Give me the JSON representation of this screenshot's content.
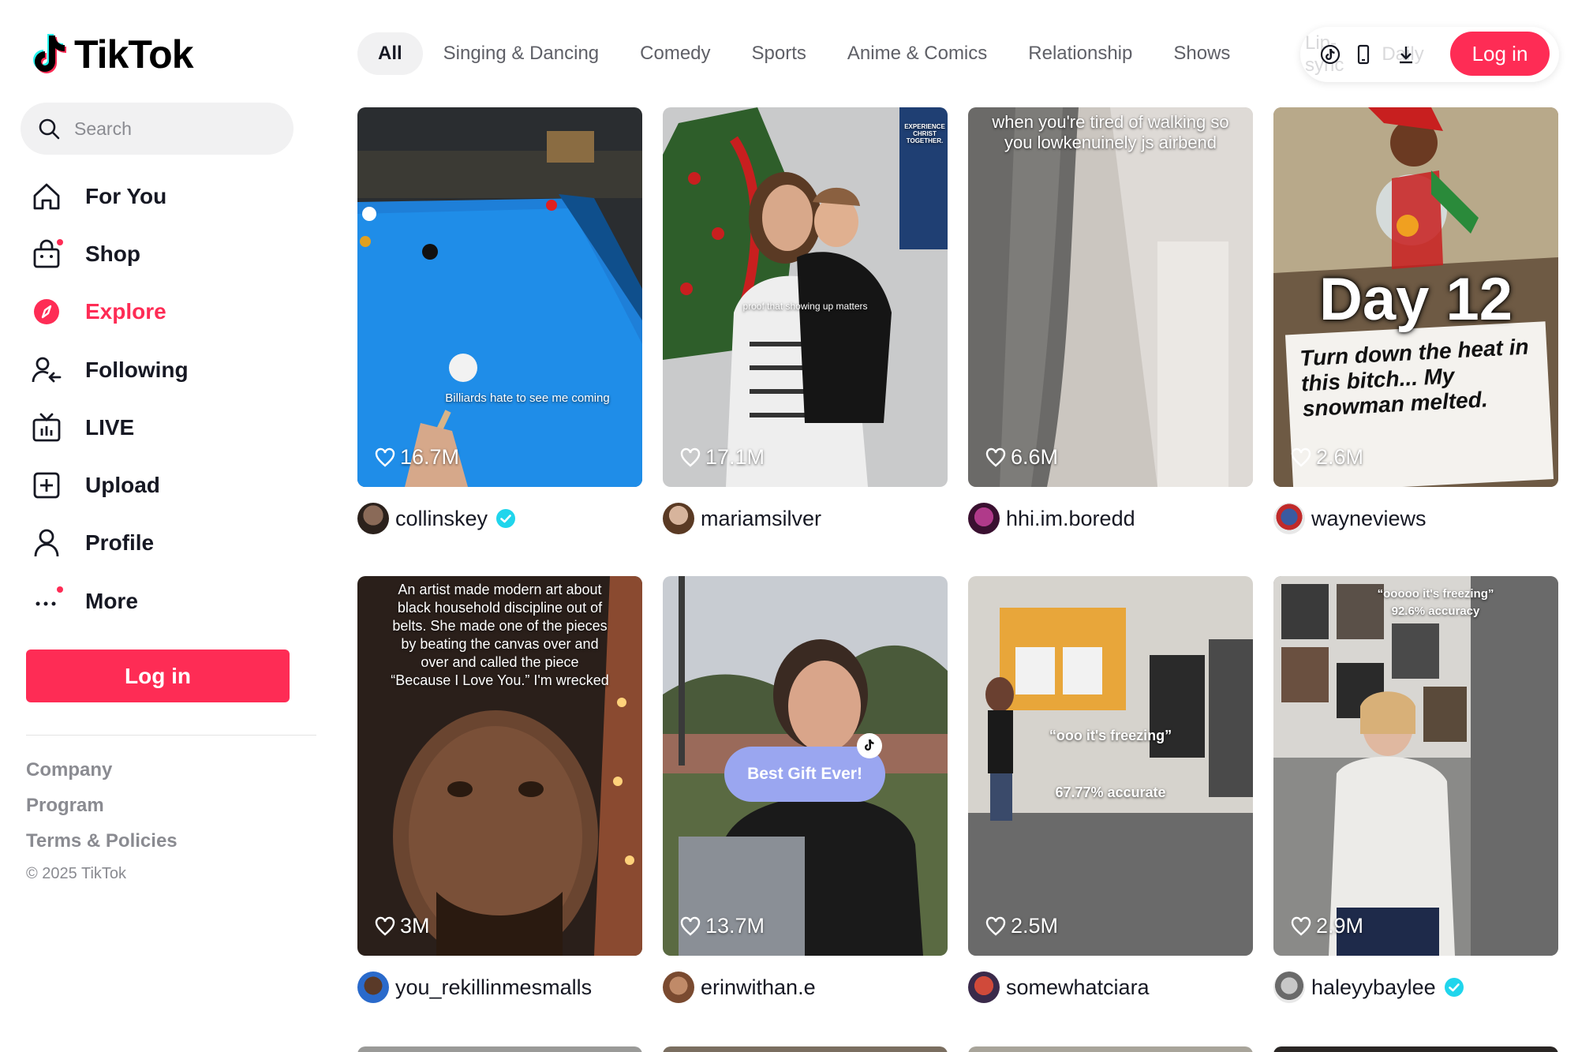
{
  "brand": {
    "name": "TikTok",
    "logo_icon": "tiktok-note-logo"
  },
  "search": {
    "placeholder": "Search",
    "icon": "search-icon"
  },
  "nav": [
    {
      "label": "For You",
      "icon": "home-icon"
    },
    {
      "label": "Shop",
      "icon": "shopping-bag-icon",
      "dot": true
    },
    {
      "label": "Explore",
      "icon": "compass-icon",
      "active": true
    },
    {
      "label": "Following",
      "icon": "following-icon"
    },
    {
      "label": "LIVE",
      "icon": "live-tv-icon"
    },
    {
      "label": "Upload",
      "icon": "upload-icon"
    },
    {
      "label": "Profile",
      "icon": "profile-icon"
    },
    {
      "label": "More",
      "icon": "more-dots-icon",
      "dot": true
    }
  ],
  "sidebar_login_label": "Log in",
  "footer": {
    "links": [
      "Company",
      "Program",
      "Terms & Policies"
    ],
    "copyright": "© 2025 TikTok"
  },
  "categories": [
    "All",
    "Singing & Dancing",
    "Comedy",
    "Sports",
    "Anime & Comics",
    "Relationship",
    "Shows"
  ],
  "top_right": {
    "faded_text": [
      "Lip-sync",
      "Daily"
    ],
    "icons": [
      "tiktok-coin-icon",
      "phone-icon",
      "download-icon"
    ],
    "login_label": "Log in"
  },
  "colors": {
    "accent": "#fe2c55",
    "verified": "#20d5ec",
    "chip_bg": "#f1f1f2"
  },
  "videos": [
    {
      "likes": "16.7M",
      "username": "collinskey",
      "verified": true,
      "caption": "Billiards hate to see me coming"
    },
    {
      "likes": "17.1M",
      "username": "mariamsilver",
      "verified": false,
      "caption": "proof that showing up matters",
      "poster_text": "EXPERIENCE CHRIST TOGETHER."
    },
    {
      "likes": "6.6M",
      "username": "hhi.im.boredd",
      "verified": false,
      "caption": "when you're tired of walking so you lowkenuinely js airbend"
    },
    {
      "likes": "2.6M",
      "username": "wayneviews",
      "verified": false,
      "caption": "Day 12",
      "sign_text": "Turn down the heat in this bitch... My snowman melted."
    },
    {
      "likes": "3M",
      "username": "you_rekillinmesmalls",
      "verified": false,
      "caption": "An artist made modern art about black household discipline out of belts. She made one of the pieces by beating the canvas over and over and called the piece “Because I Love You.” I'm wrecked"
    },
    {
      "likes": "13.7M",
      "username": "erinwithan.e",
      "verified": false,
      "caption": "Best Gift Ever!"
    },
    {
      "likes": "2.5M",
      "username": "somewhatciara",
      "verified": false,
      "caption": "“ooo it's freezing”",
      "sub_caption": "67.77% accurate"
    },
    {
      "likes": "2.9M",
      "username": "haleyybaylee",
      "verified": true,
      "caption": "“ooooo it's freezing”",
      "sub_caption": "92.6% accuracy"
    }
  ]
}
